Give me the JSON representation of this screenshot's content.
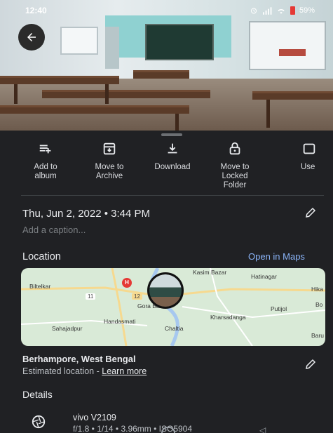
{
  "status_bar": {
    "time": "12:40",
    "battery": "59%",
    "icons": [
      "alarm-icon",
      "signal-icon",
      "wifi-icon",
      "battery-icon"
    ]
  },
  "photo": {
    "back_icon": "arrow-left-icon"
  },
  "actions": [
    {
      "label": "Add to\nalbum",
      "icon": "playlist-add-icon"
    },
    {
      "label": "Move to\nArchive",
      "icon": "archive-icon"
    },
    {
      "label": "Download",
      "icon": "download-icon"
    },
    {
      "label": "Move to\nLocked\nFolder",
      "icon": "lock-icon"
    },
    {
      "label": "Use",
      "icon": "use-as-icon"
    }
  ],
  "info": {
    "datetime": "Thu, Jun 2, 2022 • 3:44 PM",
    "caption_placeholder": "Add a caption..."
  },
  "location": {
    "title": "Location",
    "open_maps": "Open in Maps",
    "place": "Berhampore, West Bengal",
    "estimated": "Estimated location - ",
    "learn_more": "Learn more"
  },
  "map": {
    "labels": [
      "Kasim Bazar",
      "Hatinagar",
      "Biltelkar",
      "Gora Bazar",
      "Handasmati",
      "Chaltia",
      "Kharsadanga",
      "Putijol",
      "Sahajadpur",
      "Hika",
      "Baru",
      "Bo"
    ],
    "road_badges": [
      "11",
      "12"
    ]
  },
  "details": {
    "title": "Details",
    "device": "vivo V2109",
    "specs": "f/1.8 • 1/14 • 3.96mm • ISO5904"
  },
  "colors": {
    "accent": "#8ab4f8",
    "sheet_bg": "#202124",
    "text": "#e8eaed"
  }
}
